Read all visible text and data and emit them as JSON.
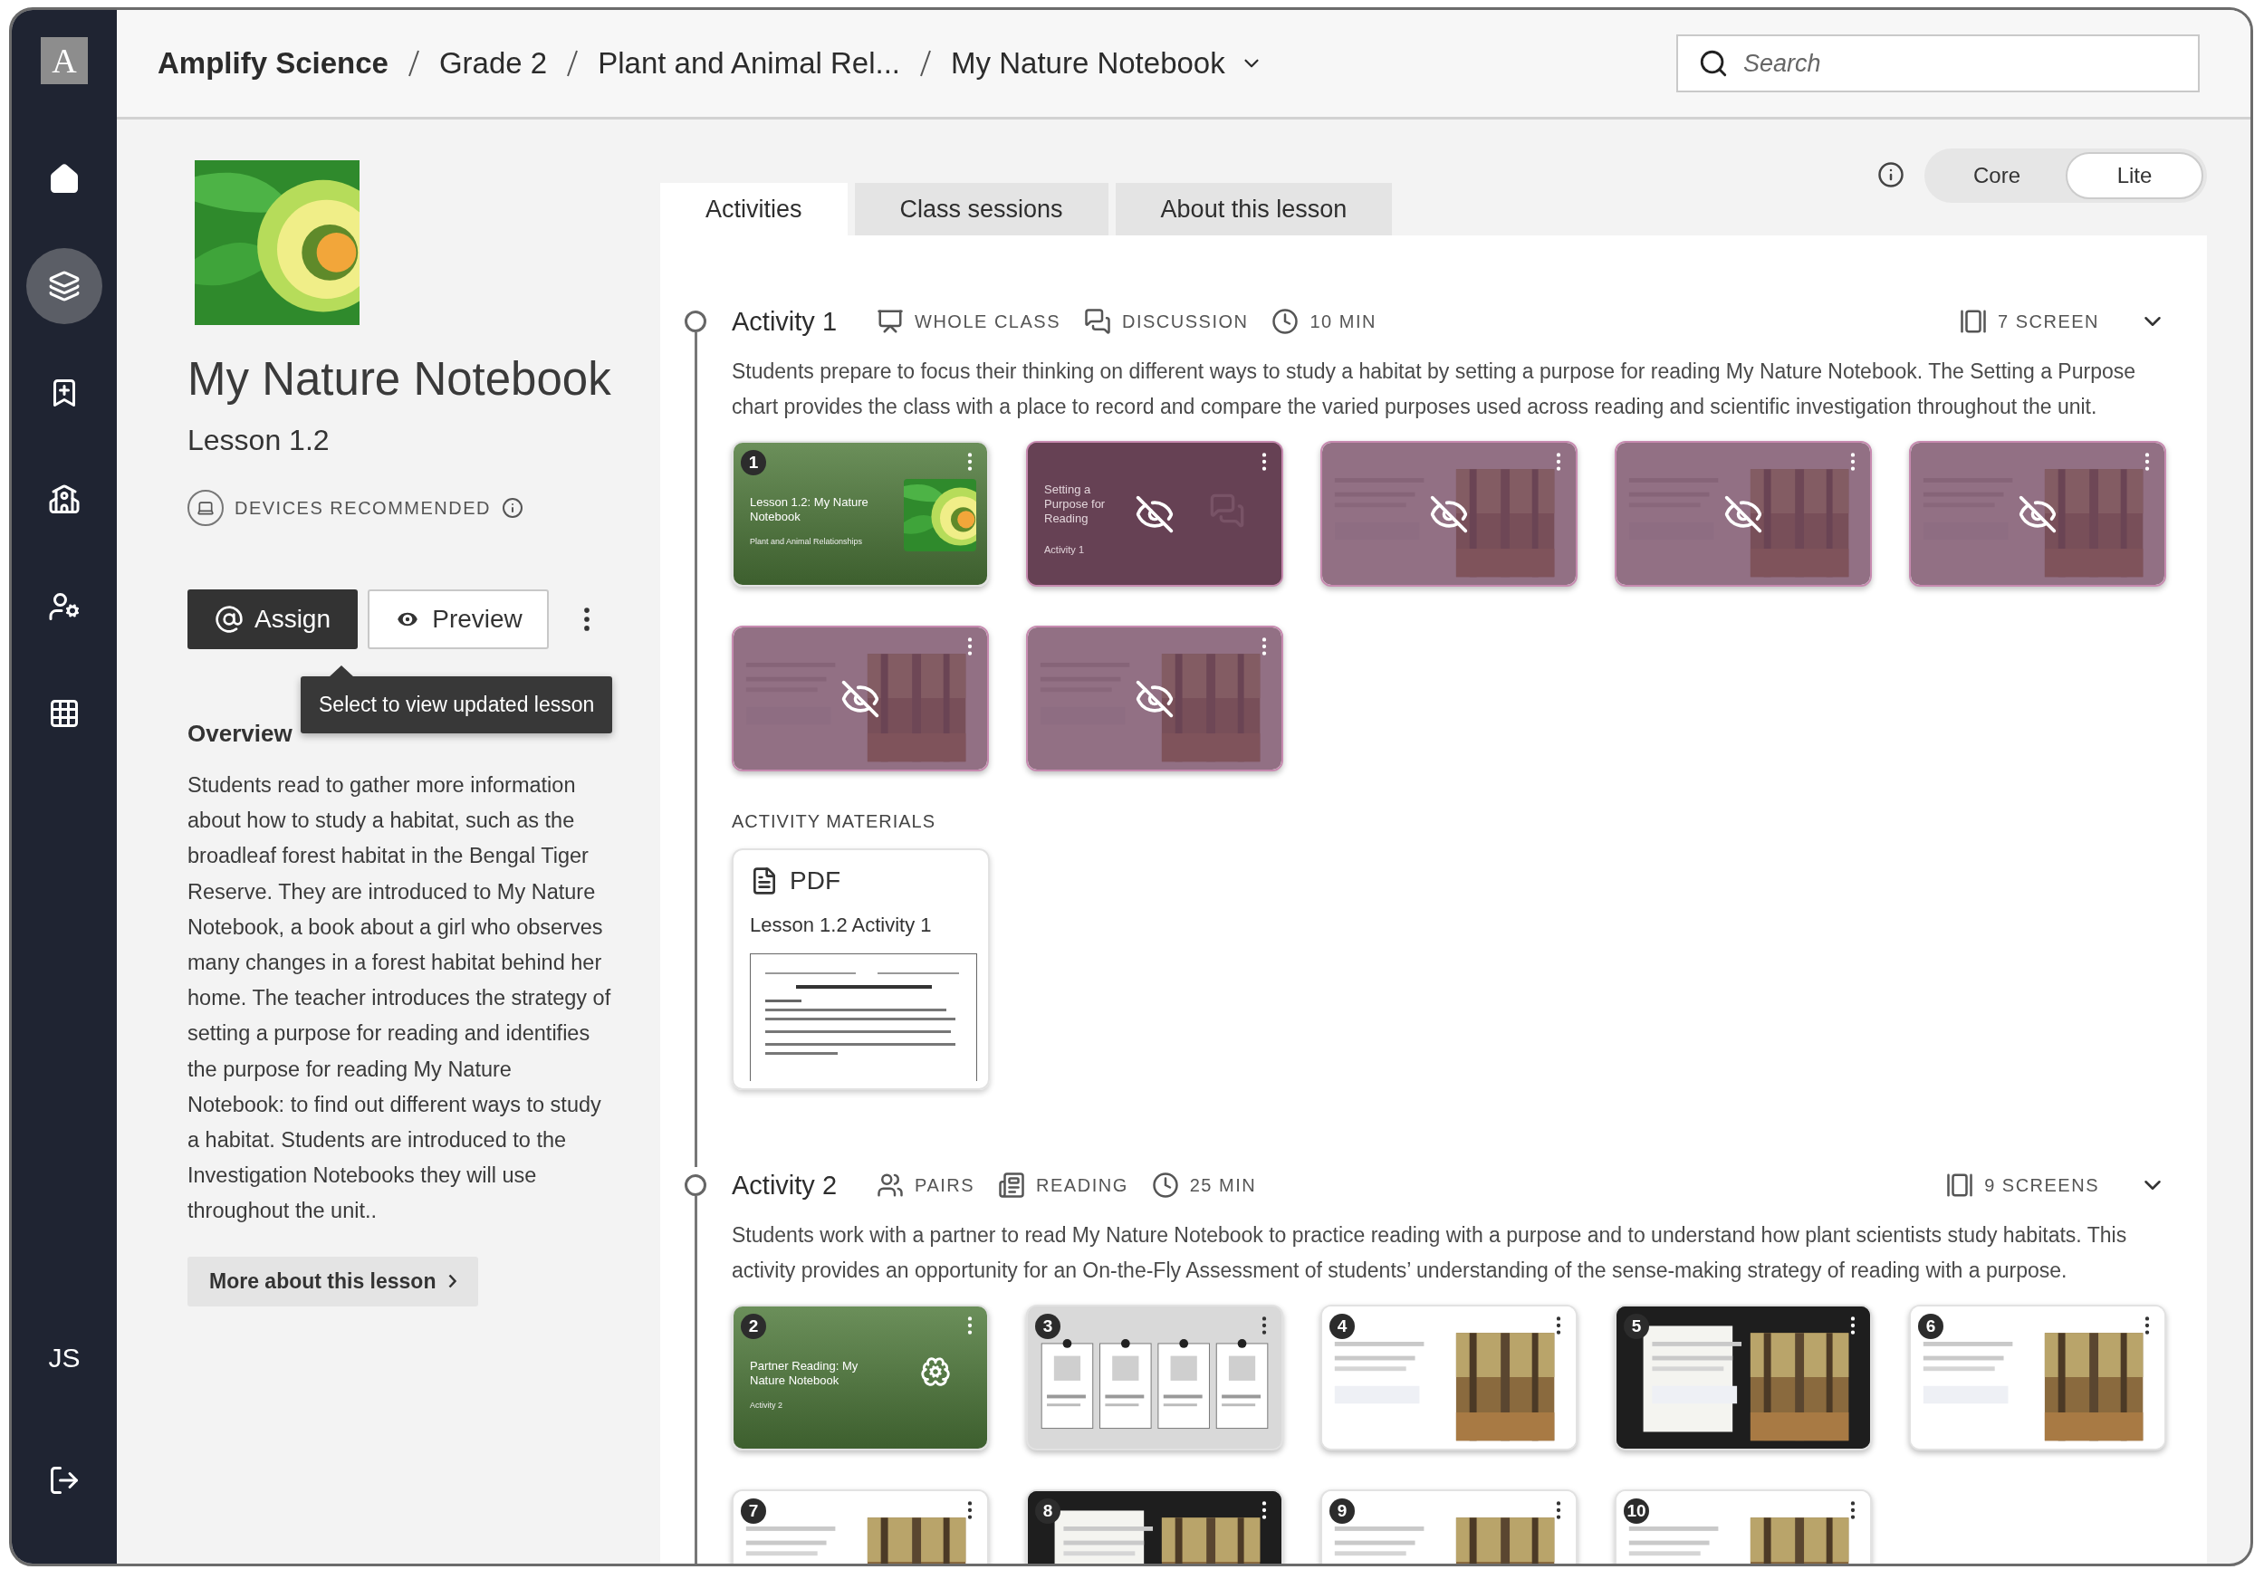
{
  "sidebar": {
    "logo": "A",
    "items": [
      {
        "kind": "home",
        "selected": false
      },
      {
        "kind": "lessons",
        "selected": true
      },
      {
        "kind": "bookmarks",
        "selected": false
      },
      {
        "kind": "teacher",
        "selected": false
      },
      {
        "kind": "user-settings",
        "selected": false
      },
      {
        "kind": "apps",
        "selected": false
      }
    ],
    "user_initials": "JS"
  },
  "breadcrumb": [
    "Amplify Science",
    "Grade 2",
    "Plant and Animal Rel...",
    "My Nature Notebook"
  ],
  "search": {
    "placeholder": "Search"
  },
  "lesson": {
    "title": "My Nature Notebook",
    "subtitle": "Lesson 1.2",
    "devices": "DEVICES RECOMMENDED",
    "assign": "Assign",
    "preview": "Preview",
    "tooltip": "Select to view updated lesson",
    "overview_heading": "Overview",
    "overview": "Students read to gather more information about how to study a habitat, such as the broadleaf forest habitat in the Bengal Tiger Reserve. They are introduced to My Nature Notebook, a book about a girl who observes many changes in a forest habitat behind her home. The teacher introduces the strategy of setting a purpose for reading and identifies the purpose for reading My Nature Notebook: to find out different ways to study a habitat. Students are introduced to the Investigation Notebooks they will use throughout the unit..",
    "more": "More about this lesson"
  },
  "mode_toggle": [
    {
      "label": "Core",
      "selected": false
    },
    {
      "label": "Lite",
      "selected": true
    }
  ],
  "tabs": [
    {
      "label": "Activities",
      "selected": true
    },
    {
      "label": "Class sessions",
      "selected": false
    },
    {
      "label": "About this lesson",
      "selected": false
    }
  ],
  "activities": [
    {
      "title": "Activity 1",
      "tags": [
        {
          "kind": "whole-class",
          "label": "WHOLE CLASS"
        },
        {
          "kind": "discussion",
          "label": "DISCUSSION"
        },
        {
          "kind": "time",
          "label": "10 MIN"
        }
      ],
      "screens": "7 SCREEN",
      "description": "Students prepare to focus their thinking on different ways to study a habitat by setting a purpose for reading My Nature Notebook. The Setting a Purpose chart provides the class with a place to record and compare the varied purposes used across reading and scientific investigation throughout the unit.",
      "slides": [
        {
          "kind": "cover",
          "number": "1",
          "hidden": false,
          "title": "Lesson 1.2: My Nature Notebook",
          "subtitle": "Plant and Animal Relationships"
        },
        {
          "kind": "intro",
          "hidden": true,
          "title": "Setting a Purpose for Reading",
          "subtitle": "Activity 1"
        },
        {
          "kind": "page",
          "hidden": true
        },
        {
          "kind": "page",
          "hidden": true
        },
        {
          "kind": "page",
          "hidden": true
        },
        {
          "kind": "page",
          "hidden": true
        },
        {
          "kind": "page",
          "hidden": true
        }
      ],
      "materials": {
        "heading": "ACTIVITY MATERIALS",
        "items": [
          {
            "type": "PDF",
            "title": "Lesson 1.2 Activity 1"
          }
        ]
      }
    },
    {
      "title": "Activity 2",
      "tags": [
        {
          "kind": "pairs",
          "label": "PAIRS"
        },
        {
          "kind": "reading",
          "label": "READING"
        },
        {
          "kind": "time",
          "label": "25 MIN"
        }
      ],
      "screens": "9 SCREENS",
      "description": "Students work with a partner to read My Nature Notebook to practice reading with a purpose and to understand how plant scientists study habitats. This activity provides an opportunity for an On-the-Fly Assessment of students’ understanding of the sense-making strategy of reading with a purpose.",
      "slides": [
        {
          "kind": "cover",
          "number": "2",
          "hidden": false,
          "title": "Partner Reading: My Nature Notebook",
          "subtitle": "Activity 2"
        },
        {
          "kind": "steps",
          "number": "3",
          "hidden": false
        },
        {
          "kind": "page",
          "number": "4",
          "hidden": false
        },
        {
          "kind": "dark-page",
          "number": "5",
          "hidden": false
        },
        {
          "kind": "page",
          "number": "6",
          "hidden": false
        },
        {
          "kind": "page",
          "number": "7",
          "hidden": false
        },
        {
          "kind": "dark-page",
          "number": "8",
          "hidden": false
        },
        {
          "kind": "page",
          "number": "9",
          "hidden": false
        },
        {
          "kind": "page",
          "number": "10",
          "hidden": false
        }
      ]
    }
  ]
}
